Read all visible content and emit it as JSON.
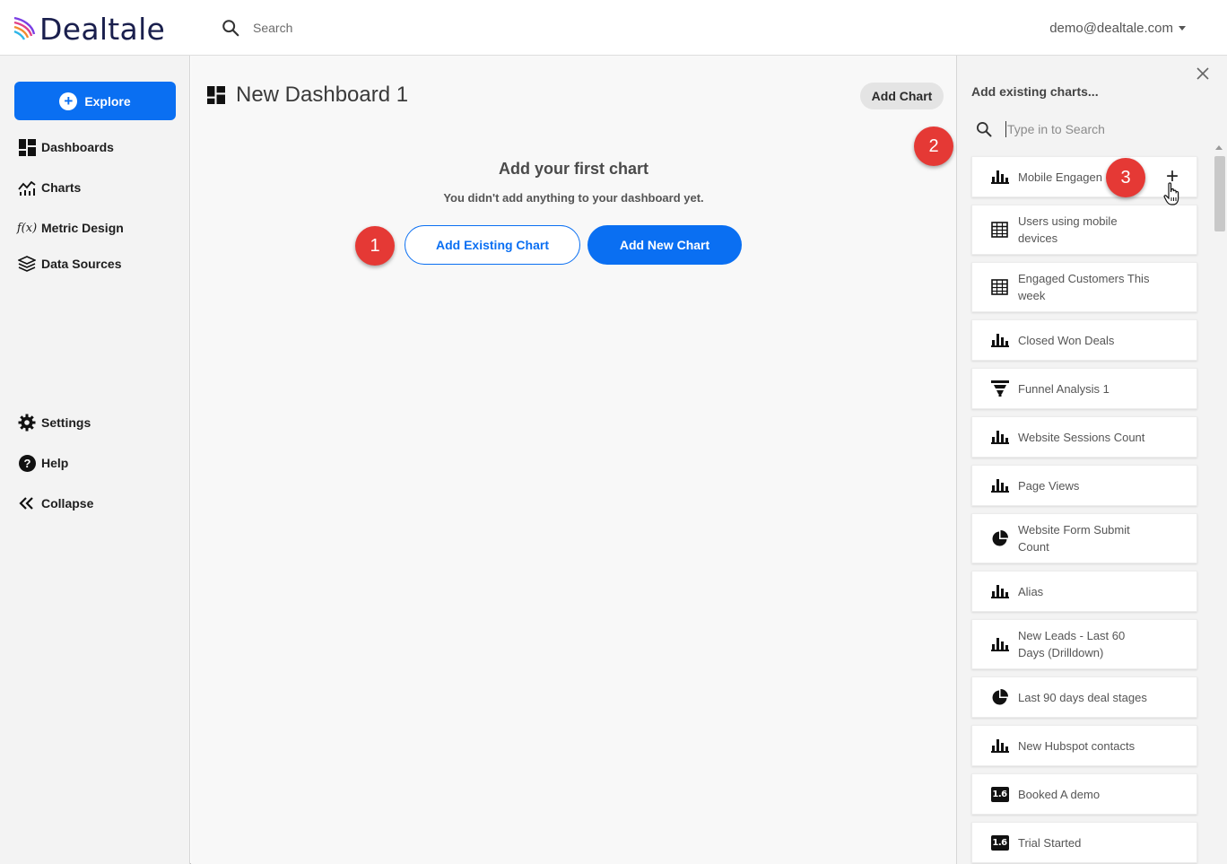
{
  "app": {
    "name": "Dealtale",
    "search_placeholder": "Search",
    "account": "demo@dealtale.com",
    "accent": "#0a6ff2"
  },
  "sidebar": {
    "explore_label": "Explore",
    "items": [
      {
        "label": "Dashboards",
        "icon": "dashboard-icon"
      },
      {
        "label": "Charts",
        "icon": "chart-line-icon"
      },
      {
        "label": "Metric Design",
        "icon": "function-icon"
      },
      {
        "label": "Data Sources",
        "icon": "layers-icon"
      }
    ],
    "bottom_items": [
      {
        "label": "Settings",
        "icon": "gear-icon"
      },
      {
        "label": "Help",
        "icon": "help-icon"
      },
      {
        "label": "Collapse",
        "icon": "chevrons-left-icon"
      }
    ]
  },
  "main": {
    "dashboard_title": "New Dashboard 1",
    "add_chart_label": "Add Chart",
    "empty_title": "Add your first chart",
    "empty_subtitle": "You didn't add anything to your dashboard yet.",
    "add_existing_label": "Add Existing Chart",
    "add_new_label": "Add New Chart"
  },
  "panel": {
    "title": "Add existing charts...",
    "search_placeholder": "Type in to Search",
    "charts": [
      {
        "label": "Mobile Engagen",
        "icon": "bar-chart-icon",
        "hover": true
      },
      {
        "label": "Users using mobile devices",
        "icon": "table-icon"
      },
      {
        "label": "Engaged Customers This week",
        "icon": "table-icon"
      },
      {
        "label": "Closed Won Deals",
        "icon": "bar-chart-icon"
      },
      {
        "label": "Funnel Analysis 1",
        "icon": "funnel-icon"
      },
      {
        "label": "Website Sessions Count",
        "icon": "bar-chart-icon"
      },
      {
        "label": "Page Views",
        "icon": "bar-chart-icon"
      },
      {
        "label": "Website Form Submit Count",
        "icon": "pie-chart-icon"
      },
      {
        "label": "Alias",
        "icon": "bar-chart-icon"
      },
      {
        "label": "New Leads - Last 60 Days (Drilldown)",
        "icon": "bar-chart-icon"
      },
      {
        "label": "Last 90 days deal stages",
        "icon": "pie-chart-icon"
      },
      {
        "label": "New Hubspot contacts",
        "icon": "bar-chart-icon"
      },
      {
        "label": "Booked A demo",
        "icon": "number-icon"
      },
      {
        "label": "Trial Started",
        "icon": "number-icon"
      }
    ],
    "number_badge": "1.6",
    "add_symbol": "+"
  },
  "callouts": [
    "1",
    "2",
    "3"
  ],
  "colors": {
    "callout": "#e53935"
  }
}
